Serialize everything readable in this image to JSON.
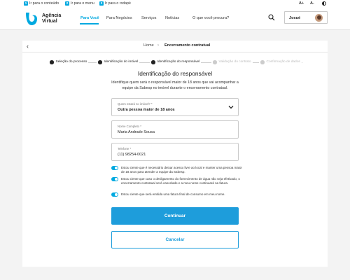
{
  "skip_links": [
    {
      "num": "1",
      "label": "Ir para o conteúdo"
    },
    {
      "num": "2",
      "label": "Ir para o menu"
    },
    {
      "num": "3",
      "label": "Ir para o rodapé"
    }
  ],
  "accessibility": {
    "increase": "A+",
    "decrease": "A-"
  },
  "header": {
    "logo_line1": "Agência",
    "logo_line2": "Virtual",
    "nav": [
      "Para Você",
      "Para Negócios",
      "Serviços",
      "Notícias"
    ],
    "search_placeholder": "O que você procura?",
    "user_name": "Josué"
  },
  "breadcrumb": {
    "home": "Home",
    "current": "Encerramento contratual"
  },
  "steps": [
    {
      "label": "Seleção do processo",
      "state": "done"
    },
    {
      "label": "Identificação do imóvel",
      "state": "done"
    },
    {
      "label": "Identificação do responsável",
      "state": "current"
    },
    {
      "label": "Validação do contrato",
      "state": "pending"
    },
    {
      "label": "Confirmação de dados",
      "state": "pending"
    }
  ],
  "form": {
    "title": "Identificação do responsável",
    "subtitle": "Identifique quem será o responsável maior de 18 anos que vai acompanhar a equipe da Sabesp no imóvel durante o encerramento contratual.",
    "presence": {
      "label": "Quem estará no imóvel? *",
      "value": "Outra pessoa maior de 18 anos"
    },
    "name": {
      "label": "Nome Completo *",
      "value": "Maria Andrade Sousa"
    },
    "phone": {
      "label": "Telefone *",
      "value": "(11) 98254-0021"
    },
    "checks": [
      "Estou ciente que é necessário deixar acesso livre ao local e manter uma pessoa maior de 18 anos para atender a equipe da Sabesp.",
      "Estou ciente que caso o desligamento do fornecimento de água não seja efetivado, o encerramento contratual será cancelado e a meu nome continuará na fatura.",
      "Estou ciente que será emitida uma fatura final de consumo em meu nome."
    ],
    "continue_label": "Continuar",
    "cancel_label": "Cancelar"
  },
  "colors": {
    "accent": "#00a9e0",
    "button": "#1e9ddb"
  }
}
